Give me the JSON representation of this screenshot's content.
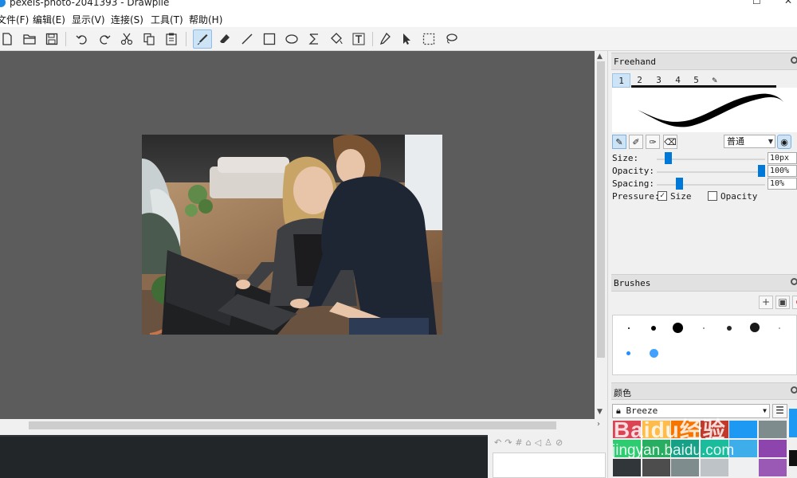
{
  "window": {
    "title": "pexels-photo-2041393 - Drawpile"
  },
  "menu": [
    {
      "label": "文件(F)"
    },
    {
      "label": "编辑(E)"
    },
    {
      "label": "显示(V)"
    },
    {
      "label": "连接(S)"
    },
    {
      "label": "工具(T)"
    },
    {
      "label": "帮助(H)"
    }
  ],
  "toolbar": {
    "icons": [
      "new-icon",
      "open-icon",
      "save-icon",
      "undo-icon",
      "redo-icon",
      "cut-icon",
      "copy-icon",
      "paste-icon",
      "freehand-icon",
      "eraser-icon",
      "line-icon",
      "rectangle-icon",
      "ellipse-icon",
      "bezier-icon",
      "fill-icon",
      "text-icon",
      "color-picker-icon",
      "select-arrow-icon",
      "rect-select-icon",
      "lasso-icon"
    ],
    "active_tool": "freehand"
  },
  "freehand_panel": {
    "title": "Freehand",
    "preset_tabs": [
      "1",
      "2",
      "3",
      "4",
      "5"
    ],
    "active_preset": "1",
    "blend_mode": "普通",
    "size_label": "Size:",
    "size_value": "10px",
    "size_level": 0.1,
    "opacity_label": "Opacity:",
    "opacity_value": "100%",
    "opacity_level": 1.0,
    "spacing_label": "Spacing:",
    "spacing_value": "10%",
    "spacing_level": 0.1,
    "pressure_label": "Pressure:",
    "pressure_size_label": "Size",
    "pressure_size_checked": true,
    "pressure_opacity_label": "Opacity",
    "pressure_opacity_checked": false
  },
  "brushes_panel": {
    "title": "Brushes"
  },
  "color_panel": {
    "title": "颜色",
    "palette_name": "Breeze",
    "swatches": [
      "#da4453",
      "#fdbc4b",
      "#f67400",
      "#c0392b",
      "#1d99f3",
      "#7f8c8d",
      "#2ecc71",
      "#27ae60",
      "#16a085",
      "#1abc9c",
      "#3daee9",
      "#8e44ad",
      "#31363b",
      "#4d4d4d",
      "#7f8c8d",
      "#bdc3c7",
      "#eff0f1",
      "#9b59b6"
    ]
  },
  "watermark": {
    "line1": "Baidu经验",
    "line2": "jingyan.baidu.com"
  }
}
